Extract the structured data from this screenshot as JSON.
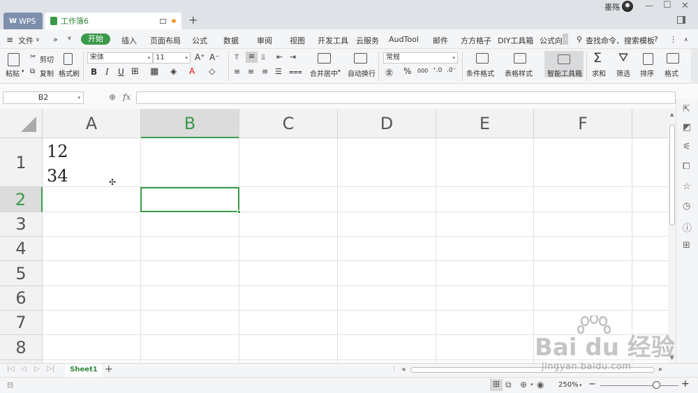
{
  "titlebar": {
    "wps_tab": "WPS",
    "workbook_tab": "工作簿6",
    "user_name": "墨殇"
  },
  "menu": {
    "file": "文件",
    "items": [
      "开始",
      "插入",
      "页面布局",
      "公式",
      "数据",
      "审阅",
      "视图",
      "开发工具",
      "云服务",
      "AudTool",
      "邮件",
      "方方格子",
      "DIY工具箱",
      "公式向"
    ],
    "search": "查找命令、搜索模板",
    "help": "?"
  },
  "ribbon": {
    "paste": "粘贴",
    "cut": "剪切",
    "copy": "复制",
    "format_painter": "格式刷",
    "font_name": "宋体",
    "font_size": "11",
    "bold": "B",
    "italic": "I",
    "underline": "U",
    "font_color_glyph": "A",
    "merge_center": "合并居中",
    "wrap_text": "自动换行",
    "number_format": "常规",
    "percent": "%",
    "thousands": "000",
    "conditional_format": "条件格式",
    "table_style": "表格样式",
    "smart_toolbox": "智能工具箱",
    "sum": "求和",
    "filter": "筛选",
    "sort": "排序",
    "format": "格式"
  },
  "formula_bar": {
    "name_box": "B2",
    "fx": "fx",
    "content": ""
  },
  "sheet": {
    "columns": [
      "A",
      "B",
      "C",
      "D",
      "E",
      "F"
    ],
    "rows": [
      "1",
      "2",
      "3",
      "4",
      "5",
      "6",
      "7",
      "8"
    ],
    "selected_col": "B",
    "selected_row": "2",
    "cell_a1_line1": "12",
    "cell_a1_line2": "34"
  },
  "sheet_tabs": {
    "active": "Sheet1",
    "add": "+"
  },
  "status": {
    "zoom": "250%",
    "zoom_minus": "−",
    "zoom_plus": "+"
  },
  "watermark": {
    "text": "Bai  du 经验",
    "url": "jingyan.baidu.com"
  },
  "colors": {
    "accent": "#3b9a4a",
    "wps_tab": "#7e8fae",
    "modified_dot": "#f39c32"
  }
}
